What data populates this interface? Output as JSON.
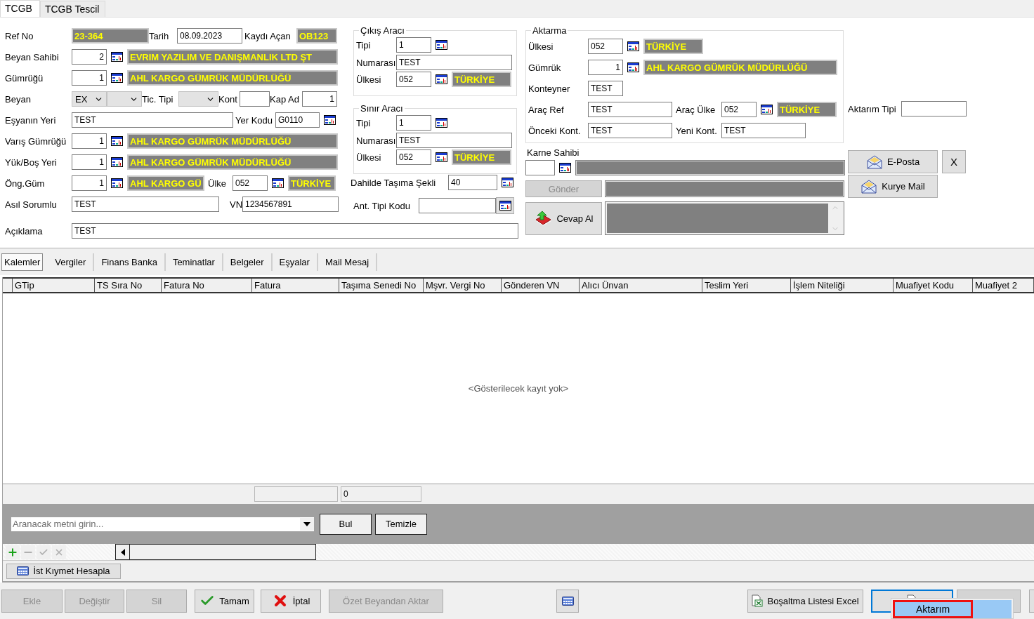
{
  "tabs": [
    {
      "label": "TCGB",
      "selected": true
    },
    {
      "label": "TCGB Tescil",
      "selected": false
    }
  ],
  "header": {
    "ref_no": {
      "label": "Ref No",
      "value": "23-364"
    },
    "tarih": {
      "label": "Tarih",
      "value": "08.09.2023"
    },
    "kaydi_acan": {
      "label": "Kaydı Açan",
      "value": "OB123"
    },
    "beyan_sahibi": {
      "label": "Beyan Sahibi",
      "code": "2",
      "name": "EVRIM YAZILIM VE DANIŞMANLIK LTD ŞT"
    },
    "gumrugu": {
      "label": "Gümrüğü",
      "code": "1",
      "name": "AHL KARGO GÜMRÜK MÜDÜRLÜĞÜ"
    },
    "beyan": {
      "label": "Beyan",
      "value": "EX"
    },
    "tic_tipi": {
      "label": "Tic. Tipi"
    },
    "kont": {
      "label": "Kont"
    },
    "kap_ad": {
      "label": "Kap Ad",
      "value": "1"
    },
    "esyanin_yeri": {
      "label": "Eşyanın Yeri",
      "value": "TEST"
    },
    "yer_kodu": {
      "label": "Yer Kodu",
      "value": "G0110"
    },
    "varis_gumrugu": {
      "label": "Varış Gümrüğü",
      "code": "1",
      "name": "AHL KARGO GÜMRÜK MÜDÜRLÜĞÜ"
    },
    "yuk_bos_yeri": {
      "label": "Yük/Boş Yeri",
      "code": "1",
      "name": "AHL KARGO GÜMRÜK MÜDÜRLÜĞÜ"
    },
    "ong_gum": {
      "label": "Öng.Güm",
      "code": "1",
      "name": "AHL KARGO GÜ"
    },
    "ulke": {
      "label": "Ülke",
      "code": "052",
      "name": "TÜRKİYE"
    },
    "asil_sorumlu": {
      "label": "Asıl Sorumlu",
      "value": "TEST"
    },
    "vn": {
      "label": "VN",
      "value": "1234567891"
    },
    "aciklama": {
      "label": "Açıklama",
      "value": "TEST"
    }
  },
  "cikis_araci": {
    "title": "Çıkış Aracı",
    "tipi": {
      "label": "Tipi",
      "value": "1"
    },
    "numarasi": {
      "label": "Numarası",
      "value": "TEST"
    },
    "ulkesi": {
      "label": "Ülkesi",
      "code": "052",
      "name": "TÜRKİYE"
    }
  },
  "sinir_araci": {
    "title": "Sınır Aracı",
    "tipi": {
      "label": "Tipi",
      "value": "1"
    },
    "numarasi": {
      "label": "Numarası",
      "value": "TEST"
    },
    "ulkesi": {
      "label": "Ülkesi",
      "code": "052",
      "name": "TÜRKİYE"
    }
  },
  "dahilde_tasima_sekli": {
    "label": "Dahilde Taşıma Şekli",
    "value": "40"
  },
  "ant_tipi_kodu": {
    "label": "Ant. Tipi Kodu"
  },
  "aktarma": {
    "title": "Aktarma",
    "ulkesi": {
      "label": "Ülkesi",
      "code": "052",
      "name": "TÜRKİYE"
    },
    "gumruk": {
      "label": "Gümrük",
      "code": "1",
      "name": "AHL KARGO GÜMRÜK MÜDÜRLÜĞÜ"
    },
    "konteyner": {
      "label": "Konteyner",
      "value": "TEST"
    },
    "arac_ref": {
      "label": "Araç Ref",
      "value": "TEST"
    },
    "arac_ulke": {
      "label": "Araç Ülke",
      "code": "052",
      "name": "TÜRKİYE"
    },
    "onceki_kont": {
      "label": "Önceki Kont.",
      "value": "TEST"
    },
    "yeni_kont": {
      "label": "Yeni Kont.",
      "value": "TEST"
    }
  },
  "aktarim_tipi": {
    "label": "Aktarım Tipi"
  },
  "karne_sahibi": {
    "label": "Karne Sahibi"
  },
  "gonder": {
    "label": "Gönder",
    "disabled": true
  },
  "cevap_al": {
    "label": "Cevap Al",
    "disabled": false
  },
  "eposta": {
    "label": "E-Posta"
  },
  "close_button": {
    "label": "X"
  },
  "kurye_mail": {
    "label": "Kurye Mail"
  },
  "detail_tabs": [
    {
      "label": "Kalemler",
      "selected": true
    },
    {
      "label": "Vergiler",
      "selected": false
    },
    {
      "label": "Finans Banka",
      "selected": false
    },
    {
      "label": "Teminatlar",
      "selected": false
    },
    {
      "label": "Belgeler",
      "selected": false
    },
    {
      "label": "Eşyalar",
      "selected": false
    },
    {
      "label": "Mail Mesaj",
      "selected": false
    }
  ],
  "grid": {
    "columns": [
      "GTip",
      "TS Sıra No",
      "Fatura No",
      "Fatura",
      "Taşıma Senedi No",
      "Mşvr. Vergi No",
      "Gönderen VN",
      "Alıcı Ünvan",
      "Teslim Yeri",
      "İşlem Niteliği",
      "Muafiyet Kodu",
      "Muafiyet 2"
    ],
    "empty_text": "<Gösterilecek kayıt yok>",
    "summary": "0"
  },
  "search": {
    "placeholder": "Aranacak metni girin...",
    "buttons": [
      "Bul",
      "Temizle"
    ]
  },
  "navigator": [
    {
      "kind": "add",
      "disabled": false
    },
    {
      "kind": "remove",
      "disabled": true
    },
    {
      "kind": "confirm",
      "disabled": true
    },
    {
      "kind": "cancel",
      "disabled": true
    }
  ],
  "ist_kiymet": {
    "label": "İst Kıymet Hesapla"
  },
  "actions": [
    {
      "label": "Ekle",
      "disabled": true
    },
    {
      "label": "Değiştir",
      "disabled": true
    },
    {
      "label": "Sil",
      "disabled": true
    },
    {
      "label": "Tamam",
      "kind": "check",
      "disabled": false
    },
    {
      "label": "İptal",
      "kind": "cross",
      "disabled": false
    },
    {
      "label": "Özet Beyandan Aktar",
      "disabled": true
    },
    {
      "kind": "calculator",
      "disabled": false
    },
    {
      "label": "Boşaltma Listesi Excel",
      "kind": "excel",
      "disabled": false
    },
    {
      "kind": "excel",
      "disabled": false,
      "focused": true
    },
    {
      "disabled": true
    },
    {
      "disabled": false
    }
  ],
  "popup_menu": [
    {
      "label": "Aktarım",
      "selected": true
    }
  ]
}
